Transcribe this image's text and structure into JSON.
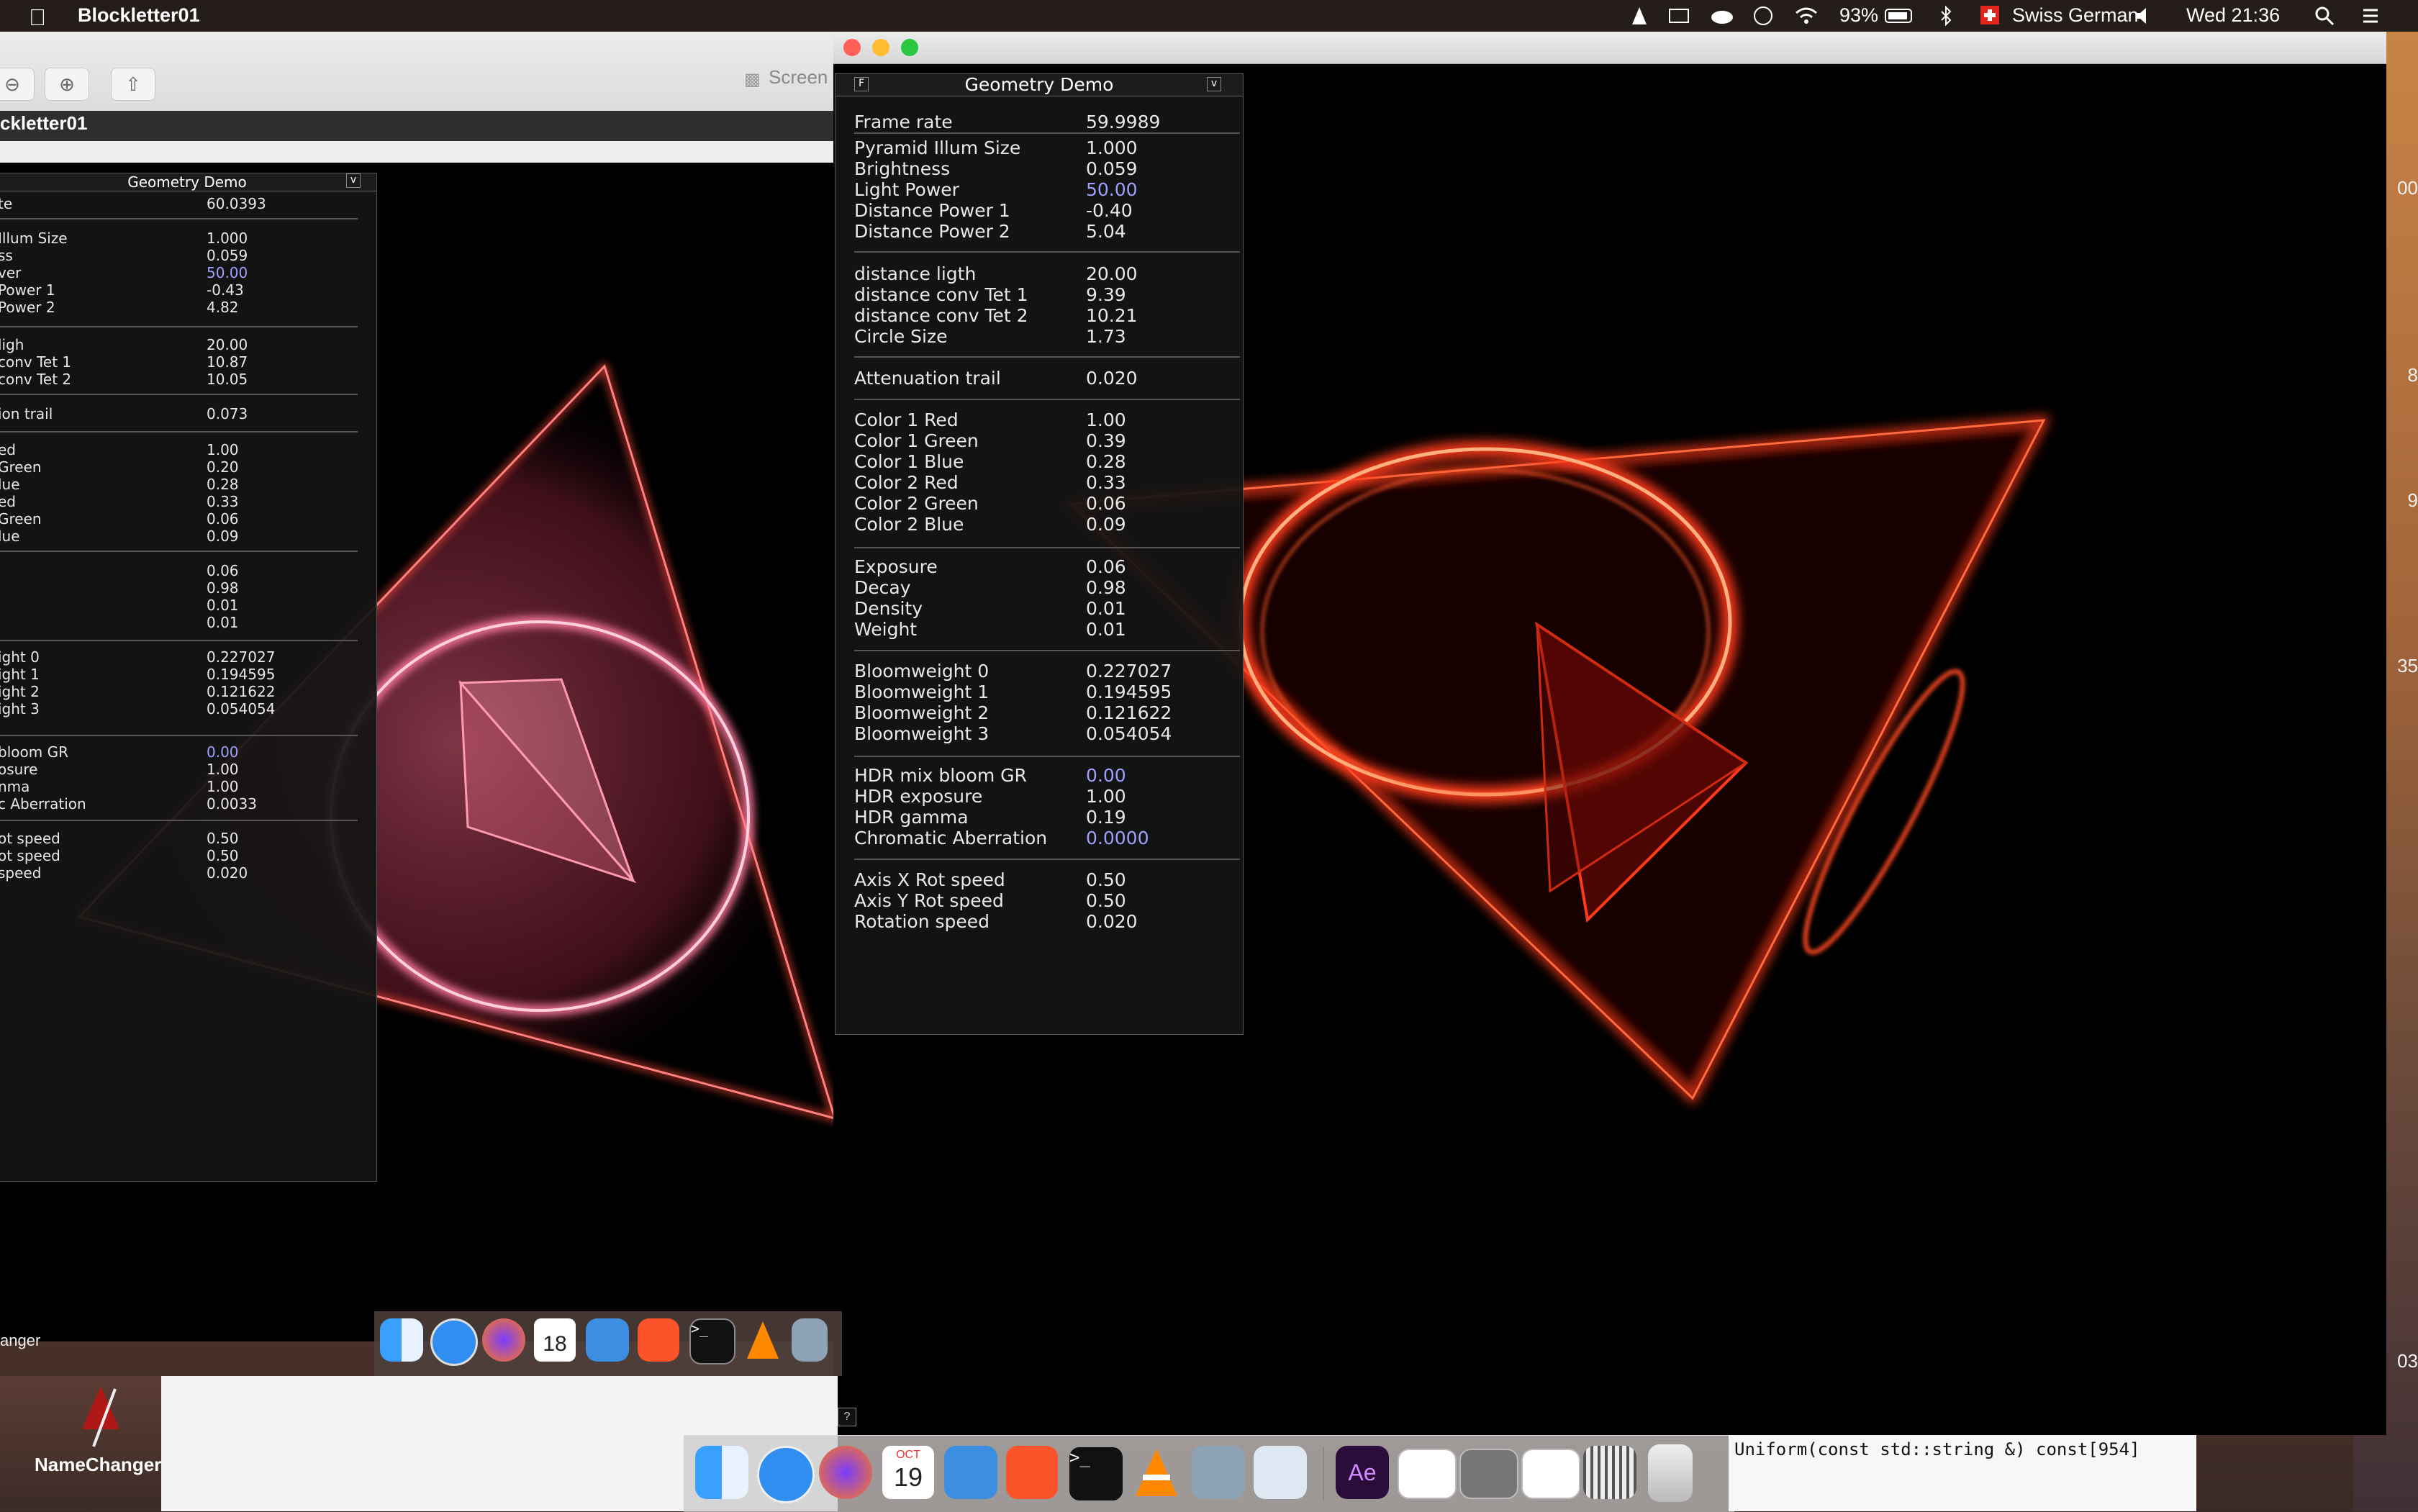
{
  "menubar": {
    "app_name": "Blockletter01",
    "battery": "93%",
    "keyboard": "Swiss German",
    "clock": "Wed 21:36"
  },
  "left_window": {
    "screen_label": "Screen",
    "title": "ckletter01",
    "panel": {
      "title": "Geometry Demo",
      "collapse_glyph": "v",
      "rows": [
        {
          "label": "te",
          "value": "60.0393"
        },
        {
          "label": "Illum Size",
          "value": "1.000"
        },
        {
          "label": "ss",
          "value": "0.059"
        },
        {
          "label": "ver",
          "value": "50.00"
        },
        {
          "label": "Power 1",
          "value": "-0.43"
        },
        {
          "label": "Power 2",
          "value": "4.82"
        },
        {
          "label": "ligh",
          "value": "20.00"
        },
        {
          "label": "conv Tet 1",
          "value": "10.87"
        },
        {
          "label": "conv Tet 2",
          "value": "10.05"
        },
        {
          "label": "ion trail",
          "value": "0.073"
        },
        {
          "label": "ed",
          "value": "1.00"
        },
        {
          "label": "Green",
          "value": "0.20"
        },
        {
          "label": "lue",
          "value": "0.28"
        },
        {
          "label": "ed",
          "value": "0.33"
        },
        {
          "label": "Green",
          "value": "0.06"
        },
        {
          "label": "lue",
          "value": "0.09"
        },
        {
          "label": "",
          "value": "0.06"
        },
        {
          "label": "",
          "value": "0.98"
        },
        {
          "label": "",
          "value": "0.01"
        },
        {
          "label": "",
          "value": "0.01"
        },
        {
          "label": "ight 0",
          "value": "0.227027"
        },
        {
          "label": "ight 1",
          "value": "0.194595"
        },
        {
          "label": "ight 2",
          "value": "0.121622"
        },
        {
          "label": "ight 3",
          "value": "0.054054"
        },
        {
          "label": " bloom GR",
          "value": "0.00"
        },
        {
          "label": "osure",
          "value": "1.00"
        },
        {
          "label": "nma",
          "value": "1.00"
        },
        {
          "label": "c Aberration",
          "value": "0.0033"
        },
        {
          "label": "ot speed",
          "value": "0.50"
        },
        {
          "label": "ot speed",
          "value": "0.50"
        },
        {
          "label": " speed",
          "value": "0.020"
        }
      ]
    }
  },
  "right_window": {
    "panel": {
      "title": "Geometry Demo",
      "left_glyph": "F",
      "collapse_glyph": "v",
      "rows": [
        {
          "label": "Frame rate",
          "value": "59.9989"
        },
        {
          "label": "Pyramid Illum Size",
          "value": "1.000"
        },
        {
          "label": "Brightness",
          "value": "0.059"
        },
        {
          "label": "Light Power",
          "value": "50.00"
        },
        {
          "label": "Distance Power 1",
          "value": "-0.40"
        },
        {
          "label": "Distance Power 2",
          "value": "5.04"
        },
        {
          "label": "distance ligth",
          "value": "20.00"
        },
        {
          "label": "distance conv Tet 1",
          "value": "9.39"
        },
        {
          "label": "distance conv Tet 2",
          "value": "10.21"
        },
        {
          "label": "Circle Size",
          "value": "1.73"
        },
        {
          "label": "Attenuation trail",
          "value": "0.020"
        },
        {
          "label": "Color 1 Red",
          "value": "1.00"
        },
        {
          "label": "Color 1 Green",
          "value": "0.39"
        },
        {
          "label": "Color 1 Blue",
          "value": "0.28"
        },
        {
          "label": "Color 2 Red",
          "value": "0.33"
        },
        {
          "label": "Color 2 Green",
          "value": "0.06"
        },
        {
          "label": "Color 2 Blue",
          "value": "0.09"
        },
        {
          "label": "Exposure",
          "value": "0.06"
        },
        {
          "label": "Decay",
          "value": "0.98"
        },
        {
          "label": "Density",
          "value": "0.01"
        },
        {
          "label": "Weight",
          "value": "0.01"
        },
        {
          "label": "Bloomweight 0",
          "value": "0.227027"
        },
        {
          "label": "Bloomweight 1",
          "value": "0.194595"
        },
        {
          "label": "Bloomweight 2",
          "value": "0.121622"
        },
        {
          "label": "Bloomweight 3",
          "value": "0.054054"
        },
        {
          "label": "HDR mix bloom GR",
          "value": "0.00"
        },
        {
          "label": "HDR exposure",
          "value": "1.00"
        },
        {
          "label": "HDR gamma",
          "value": "0.19"
        },
        {
          "label": "Chromatic Aberration",
          "value": "0.0000"
        },
        {
          "label": "Axis X Rot speed",
          "value": "0.50"
        },
        {
          "label": "Axis Y Rot speed",
          "value": "0.50"
        },
        {
          "label": "Rotation speed",
          "value": "0.020"
        }
      ],
      "help_glyph": "?"
    }
  },
  "desktop": {
    "right_edge_numbers": [
      "00",
      "8",
      "9",
      "35",
      "03"
    ],
    "namechanger_label": "NameChanger",
    "anger_label": "anger",
    "code_text": "Uniform(const std::string &) const[954]",
    "calendar_small": {
      "month": "OCT",
      "day": "18"
    },
    "calendar_big": {
      "month": "OCT",
      "day": "19"
    },
    "ae_label": "Ae",
    "terminal_glyph": ">_"
  },
  "colors": {
    "value_blue": "#9f9fff",
    "glow_red": "#ff3a1a",
    "glow_pink": "#ff5a7a"
  }
}
